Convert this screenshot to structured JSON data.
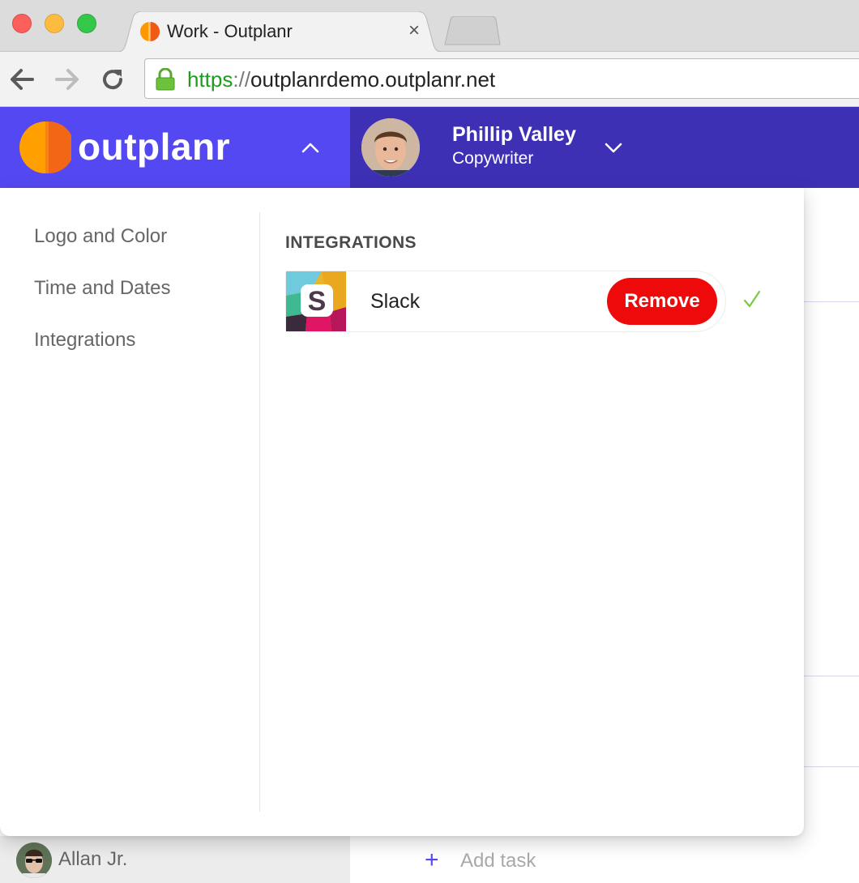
{
  "browser": {
    "tab_title": "Work - Outplanr",
    "tab_close": "×",
    "url_scheme": "https",
    "url_separator": "://",
    "url_host": "outplanrdemo.outplanr.net"
  },
  "header": {
    "brand": "outplanr",
    "user_name": "Phillip Valley",
    "user_role": "Copywriter",
    "left_color": "#5448f2",
    "right_color": "#3e30b5"
  },
  "settings": {
    "sidebar": [
      {
        "label": "Logo and Color"
      },
      {
        "label": "Time and Dates"
      },
      {
        "label": "Integrations"
      }
    ],
    "section_title": "INTEGRATIONS",
    "integrations": [
      {
        "name": "Slack",
        "action_label": "Remove",
        "status_icon": "check-icon",
        "action_color": "#ee0a0a",
        "status_color": "#7ac943"
      }
    ]
  },
  "background": {
    "member_name": "Allan Jr.",
    "add_task_plus": "+",
    "add_task_label": "Add task"
  }
}
